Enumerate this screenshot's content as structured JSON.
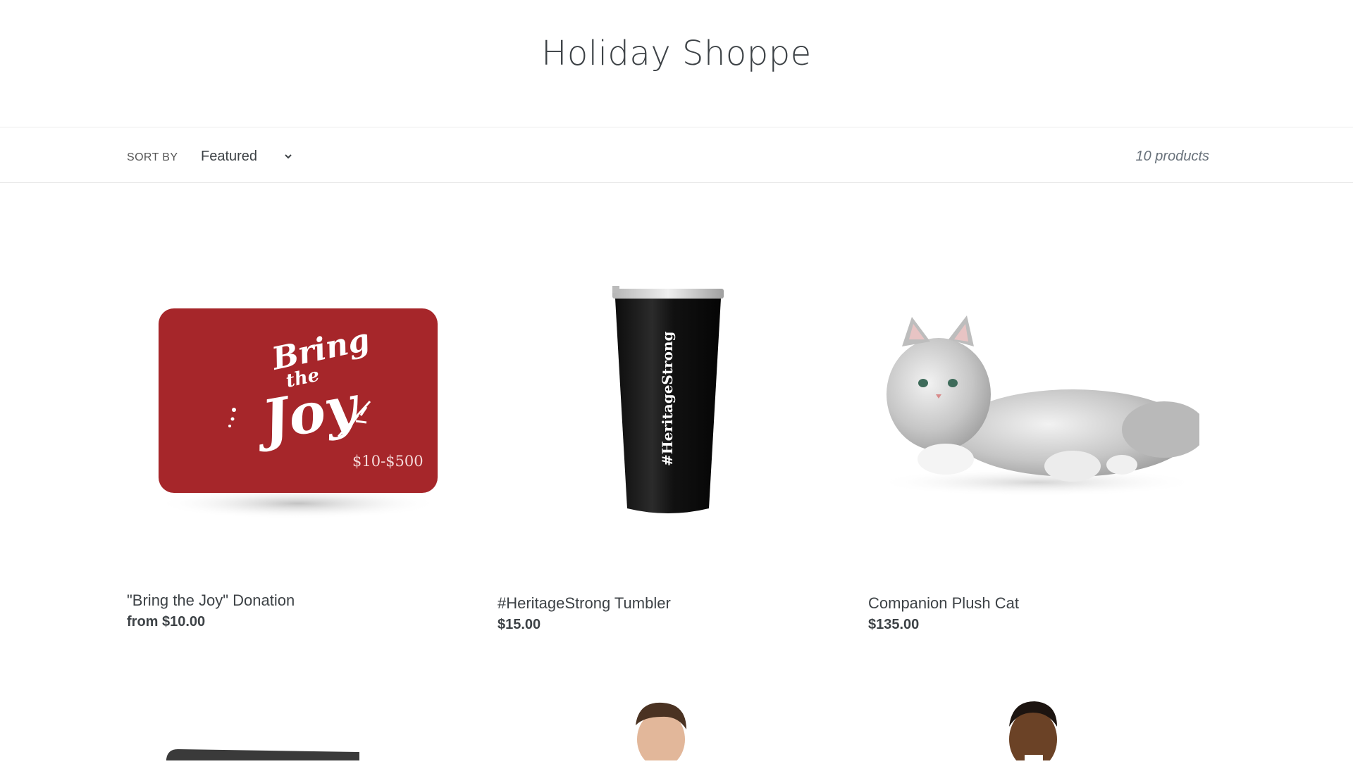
{
  "page": {
    "title": "Holiday Shoppe"
  },
  "filters": {
    "sort_label": "SORT BY",
    "sort_value": "Featured",
    "product_count": "10 products"
  },
  "products": [
    {
      "title": "\"Bring the Joy\" Donation",
      "price": "from $10.00",
      "image_text": {
        "line1": "Bring",
        "line2": "the",
        "line3": "Joy",
        "range": "$10-$500"
      }
    },
    {
      "title": "#HeritageStrong Tumbler",
      "price": "$15.00",
      "image_text": {
        "label": "#HeritageStrong"
      }
    },
    {
      "title": "Companion Plush Cat",
      "price": "$135.00"
    }
  ],
  "colors": {
    "card_red": "#a6262a",
    "tumbler_black": "#1a1a1a"
  }
}
